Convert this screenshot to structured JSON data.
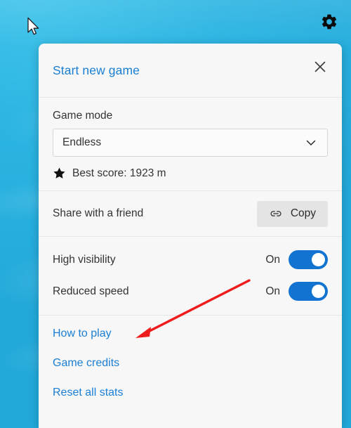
{
  "app": {
    "background_color": "#2bb4e2",
    "accent_link_color": "#1a7fd4",
    "toggle_on_color": "#1274d0",
    "panel_background": "#f7f7f7"
  },
  "toolbar": {
    "settings_icon": "gear-icon"
  },
  "panel": {
    "header": {
      "title_link": "Start new game",
      "close_icon": "close-icon"
    },
    "game_mode": {
      "label": "Game mode",
      "selected_value": "Endless",
      "dropdown_icon": "chevron-down-icon"
    },
    "best_score": {
      "icon": "star-icon",
      "text": "Best score: 1923 m"
    },
    "share": {
      "label": "Share with a friend",
      "copy_button_label": "Copy",
      "copy_button_icon": "link-icon"
    },
    "toggles": [
      {
        "label": "High visibility",
        "state": "On",
        "value": true
      },
      {
        "label": "Reduced speed",
        "state": "On",
        "value": true
      }
    ],
    "links": [
      "How to play",
      "Game credits",
      "Reset all stats"
    ]
  },
  "annotation": {
    "color": "#ee1c1c",
    "points_to": "How to play"
  }
}
